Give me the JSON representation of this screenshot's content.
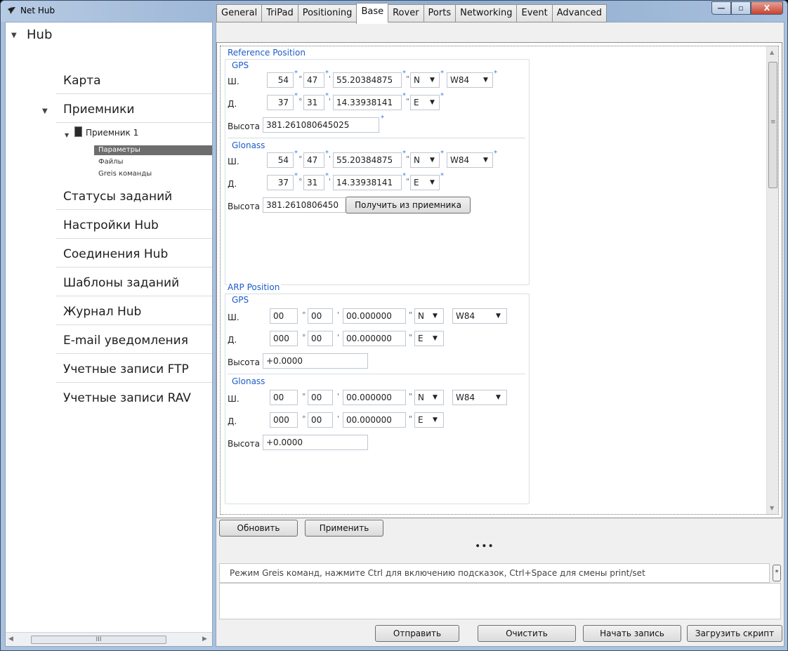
{
  "window": {
    "title": "Net Hub"
  },
  "tree": {
    "root": "Hub",
    "items": [
      "Карта",
      "Приемники",
      "Статусы заданий",
      "Настройки Hub",
      "Соединения Hub",
      "Шаблоны заданий",
      "Журнал Hub",
      "E-mail уведомления",
      "Учетные записи FTP",
      "Учетные записи RAV"
    ],
    "receiver": "Приемник 1",
    "receiver_children": [
      "Параметры",
      "Файлы",
      "Greis команды"
    ]
  },
  "tabs": [
    "General",
    "TriPad",
    "Positioning",
    "Base",
    "Rover",
    "Ports",
    "Networking",
    "Event",
    "Advanced"
  ],
  "active_tab": "Base",
  "reference_position": {
    "title": "Reference Position",
    "gps": {
      "title": "GPS",
      "lat_label": "Ш.",
      "lat_deg": "54",
      "lat_min": "47",
      "lat_sec": "55.20384875",
      "lat_hem": "N",
      "datum": "W84",
      "lon_label": "Д.",
      "lon_deg": "37",
      "lon_min": "31",
      "lon_sec": "14.33938141",
      "lon_hem": "E",
      "height_label": "Высота",
      "height": "381.261080645025"
    },
    "glonass": {
      "title": "Glonass",
      "lat_label": "Ш.",
      "lat_deg": "54",
      "lat_min": "47",
      "lat_sec": "55.20384875",
      "lat_hem": "N",
      "datum": "W84",
      "lon_label": "Д.",
      "lon_deg": "37",
      "lon_min": "31",
      "lon_sec": "14.33938141",
      "lon_hem": "E",
      "height_label": "Высота",
      "height": "381.2610806450",
      "get_button": "Получить из приемника"
    }
  },
  "arp_position": {
    "title": "ARP Position",
    "gps": {
      "title": "GPS",
      "lat_label": "Ш.",
      "lat_deg": "00",
      "lat_min": "00",
      "lat_sec": "00.000000",
      "lat_hem": "N",
      "datum": "W84",
      "lon_label": "Д.",
      "lon_deg": "000",
      "lon_min": "00",
      "lon_sec": "00.000000",
      "lon_hem": "E",
      "height_label": "Высота",
      "height": "+0.0000"
    },
    "glonass": {
      "title": "Glonass",
      "lat_label": "Ш.",
      "lat_deg": "00",
      "lat_min": "00",
      "lat_sec": "00.000000",
      "lat_hem": "N",
      "datum": "W84",
      "lon_label": "Д.",
      "lon_deg": "000",
      "lon_min": "00",
      "lon_sec": "00.000000",
      "lon_hem": "E",
      "height_label": "Высота",
      "height": "+0.0000"
    }
  },
  "actions": {
    "refresh": "Обновить",
    "apply": "Применить"
  },
  "splitter": "•••",
  "command": {
    "hint": "Режим Greis команд, нажмите  Ctrl для включению подсказок, Ctrl+Space для смены print/set",
    "send": "Отправить",
    "clear": "Очистить",
    "record": "Начать запись",
    "load_script": "Загрузить скрипт"
  },
  "symbols": {
    "deg": "°",
    "min": "'",
    "sec": "\"",
    "star": "*"
  },
  "icons": {
    "app": "checkmark-logo-icon",
    "minimize": "minimize-icon",
    "maximize": "maximize-icon",
    "close": "close-icon",
    "expand": "expand-arrow-icon",
    "receiver": "receiver-device-icon",
    "dropdown": "chevron-down-icon"
  },
  "window_buttons": {
    "minimize": "—",
    "maximize": "▫",
    "close": "X"
  },
  "scroll": {
    "up": "▲",
    "down": "▼",
    "left": "◀",
    "right": "▶",
    "grip": "III",
    "vgrip": "≡"
  }
}
